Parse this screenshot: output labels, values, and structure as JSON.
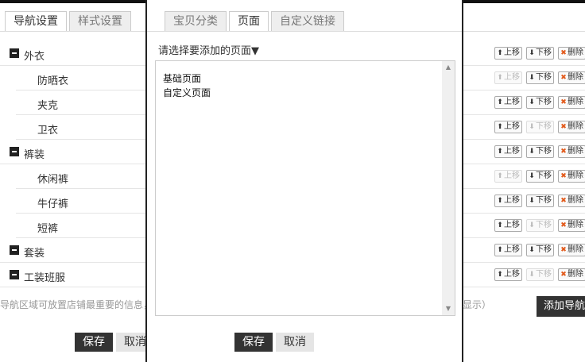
{
  "nav_panel": {
    "tabs": [
      {
        "label": "导航设置",
        "active": true
      },
      {
        "label": "样式设置",
        "active": false
      }
    ],
    "rows": [
      {
        "label": "外衣",
        "level": "parent",
        "up_enabled": true,
        "down_enabled": true
      },
      {
        "label": "防晒衣",
        "level": "child",
        "up_enabled": false,
        "down_enabled": true
      },
      {
        "label": "夹克",
        "level": "child",
        "up_enabled": true,
        "down_enabled": true
      },
      {
        "label": "卫衣",
        "level": "child",
        "up_enabled": true,
        "down_enabled": false
      },
      {
        "label": "裤装",
        "level": "parent",
        "up_enabled": true,
        "down_enabled": true
      },
      {
        "label": "休闲裤",
        "level": "child",
        "up_enabled": false,
        "down_enabled": true
      },
      {
        "label": "牛仔裤",
        "level": "child",
        "up_enabled": true,
        "down_enabled": true
      },
      {
        "label": "短裤",
        "level": "child",
        "up_enabled": true,
        "down_enabled": false
      },
      {
        "label": "套装",
        "level": "parent",
        "up_enabled": true,
        "down_enabled": true
      },
      {
        "label": "工装班服",
        "level": "parent",
        "up_enabled": true,
        "down_enabled": false
      }
    ],
    "ops": {
      "up": "上移",
      "down": "下移",
      "delete": "删除"
    },
    "hint_left": "导航区域可放置店铺最重要的信息，",
    "hint_right": "不显示）",
    "add_nav_button": "添加导航",
    "save_button": "保存",
    "cancel_button": "取消"
  },
  "modal": {
    "tabs": [
      {
        "label": "宝贝分类",
        "active": false
      },
      {
        "label": "页面",
        "active": true
      },
      {
        "label": "自定义链接",
        "active": false
      }
    ],
    "select_label": "请选择要添加的页面▼",
    "options": [
      "基础页面",
      "自定义页面"
    ],
    "save_button": "保存",
    "cancel_button": "取消"
  },
  "colors": {
    "dark": "#333333",
    "delete_icon": "#e25a1b",
    "border": "#cccccc"
  }
}
